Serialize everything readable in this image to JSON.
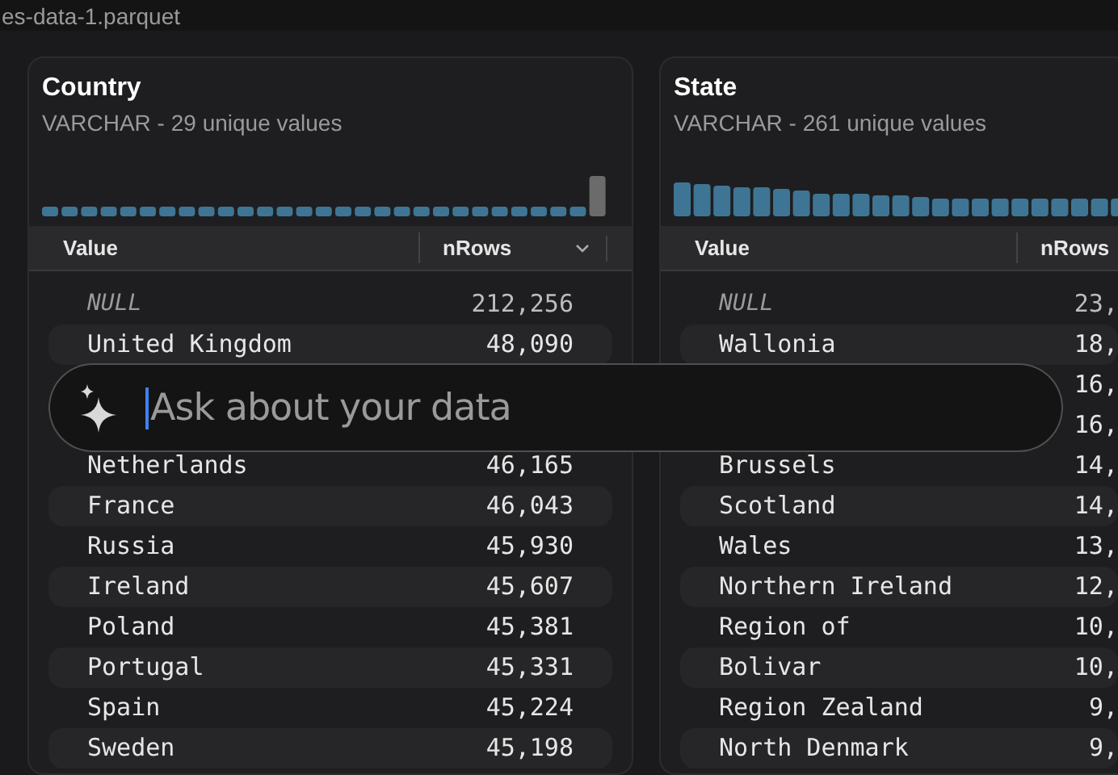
{
  "window": {
    "title": "es-data-1.parquet"
  },
  "columns": [
    {
      "name": "Country",
      "subtitle": "VARCHAR - 29 unique values",
      "headers": [
        "Value",
        "nRows"
      ],
      "rows": [
        {
          "value": "NULL",
          "is_null": true,
          "count": "212,256"
        },
        {
          "value": "United Kingdom",
          "is_null": false,
          "count": "48,090"
        },
        {},
        {},
        {
          "value": "Netherlands",
          "is_null": false,
          "count": "46,165"
        },
        {
          "value": "France",
          "is_null": false,
          "count": "46,043"
        },
        {
          "value": "Russia",
          "is_null": false,
          "count": "45,930"
        },
        {
          "value": "Ireland",
          "is_null": false,
          "count": "45,607"
        },
        {
          "value": "Poland",
          "is_null": false,
          "count": "45,381"
        },
        {
          "value": "Portugal",
          "is_null": false,
          "count": "45,331"
        },
        {
          "value": "Spain",
          "is_null": false,
          "count": "45,224"
        },
        {
          "value": "Sweden",
          "is_null": false,
          "count": "45,198"
        }
      ]
    },
    {
      "name": "State",
      "subtitle": "VARCHAR - 261 unique values",
      "headers": [
        "Value",
        "nRows"
      ],
      "rows": [
        {
          "value": "NULL",
          "is_null": true,
          "count": "23,"
        },
        {
          "value": "Wallonia",
          "is_null": false,
          "count": "18,"
        },
        {
          "count": "16,"
        },
        {
          "count": "16,"
        },
        {
          "value": "Brussels",
          "is_null": false,
          "count": "14,"
        },
        {
          "value": "Scotland",
          "is_null": false,
          "count": "14,"
        },
        {
          "value": "Wales",
          "is_null": false,
          "count": "13,"
        },
        {
          "value": "Northern Ireland",
          "is_null": false,
          "count": "12,"
        },
        {
          "value": "Region of",
          "is_null": false,
          "count": "10,"
        },
        {
          "value": "Bolivar",
          "is_null": false,
          "count": "10,"
        },
        {
          "value": "Region Zealand",
          "is_null": false,
          "count": "9,"
        },
        {
          "value": "North Denmark",
          "is_null": false,
          "count": "9,"
        }
      ]
    }
  ],
  "ask_bar": {
    "placeholder": "Ask about your data"
  }
}
